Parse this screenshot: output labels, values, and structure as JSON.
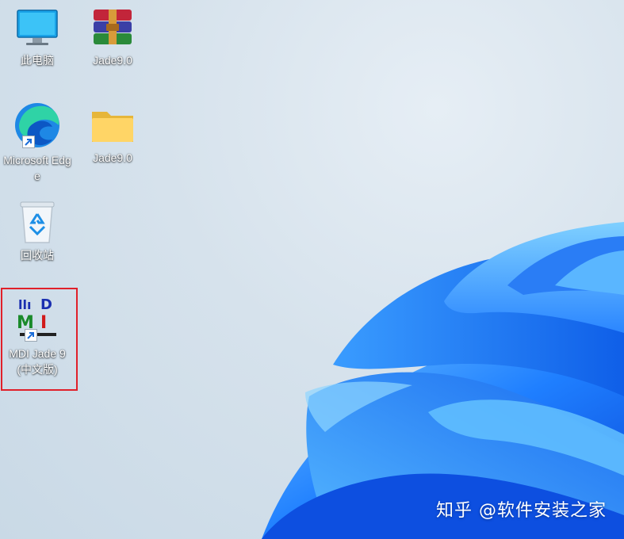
{
  "desktop": {
    "icons": [
      {
        "label": "此电脑",
        "icon": "this-pc-monitor-icon"
      },
      {
        "label": "Jade9.0",
        "icon": "winrar-archive-icon"
      },
      {
        "label": "Microsoft Edge",
        "icon": "microsoft-edge-icon",
        "shortcut": true
      },
      {
        "label": "Jade9.0",
        "icon": "folder-icon"
      },
      {
        "label": "回收站",
        "icon": "recycle-bin-icon"
      },
      {
        "label": "MDI Jade 9(中文版)",
        "icon": "mdi-jade-icon",
        "shortcut": true,
        "highlighted": true
      }
    ],
    "highlight_color": "#e0202a",
    "wallpaper": "windows-11-bloom"
  },
  "watermark": "知乎 @软件安装之家"
}
